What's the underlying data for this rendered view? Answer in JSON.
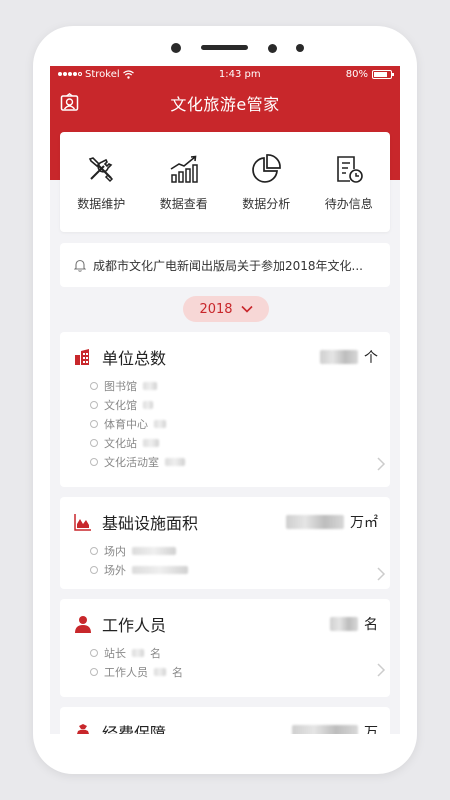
{
  "status_bar": {
    "carrier": "Strokel",
    "time": "1:43 pm",
    "battery": "80%",
    "battery_level": 0.8
  },
  "header": {
    "title": "文化旅游e管家"
  },
  "quick_actions": [
    {
      "label": "数据维护",
      "icon": "wrench-screwdriver-icon"
    },
    {
      "label": "数据查看",
      "icon": "bar-chart-trend-icon"
    },
    {
      "label": "数据分析",
      "icon": "pie-chart-icon"
    },
    {
      "label": "待办信息",
      "icon": "document-clock-icon"
    }
  ],
  "notice": {
    "text": "成都市文化广电新闻出版局关于参加2018年文化..."
  },
  "year_selector": {
    "value": "2018"
  },
  "stats": {
    "units": {
      "title": "单位总数",
      "unit": "个",
      "items": [
        "图书馆",
        "文化馆",
        "体育中心",
        "文化站",
        "文化活动室"
      ]
    },
    "area": {
      "title": "基础设施面积",
      "unit": "万㎡",
      "items": [
        "场内",
        "场外"
      ]
    },
    "staff": {
      "title": "工作人员",
      "unit": "名",
      "items": [
        "站长",
        "工作人员"
      ],
      "item_suffix": "名"
    },
    "funding": {
      "title": "经费保障",
      "unit": "万"
    }
  },
  "colors": {
    "brand_red": "#c8272b",
    "pill_bg": "#f7d7d6",
    "screen_bg": "#f3f3f6"
  }
}
